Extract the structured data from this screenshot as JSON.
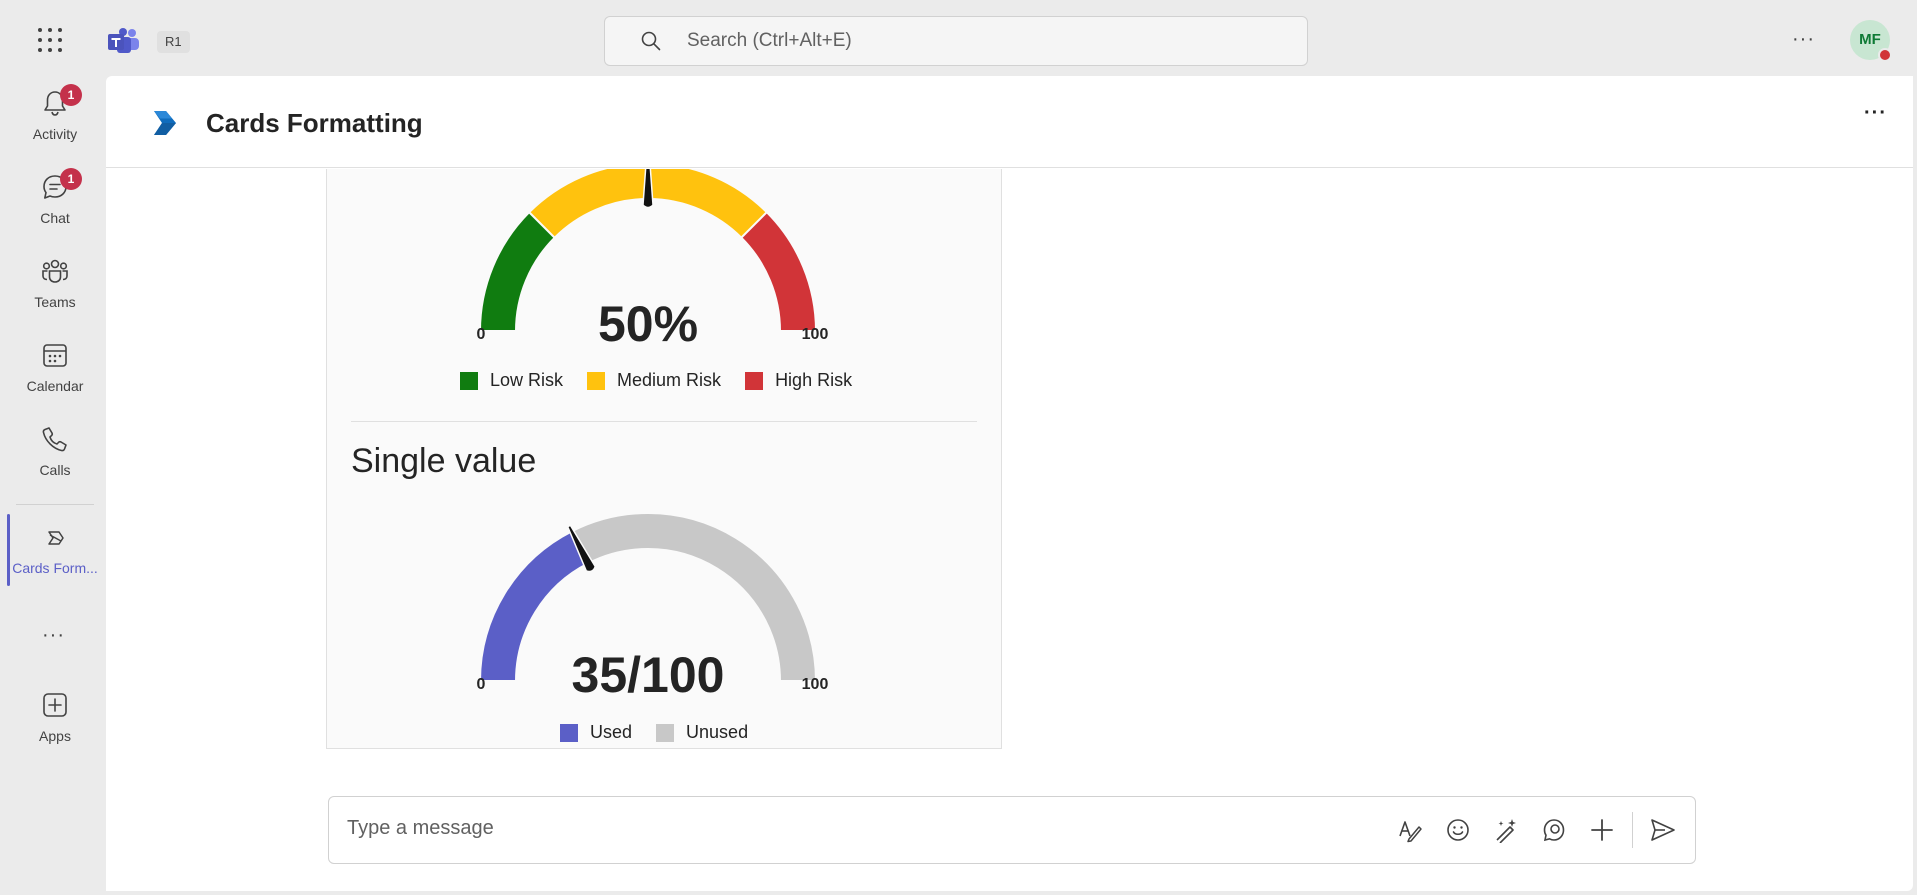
{
  "topbar": {
    "org_badge": "R1",
    "search_placeholder": "Search (Ctrl+Alt+E)",
    "avatar_initials": "MF"
  },
  "rail": {
    "items": [
      {
        "label": "Activity",
        "icon": "bell-icon",
        "badge": "1"
      },
      {
        "label": "Chat",
        "icon": "chat-icon",
        "badge": "1"
      },
      {
        "label": "Teams",
        "icon": "teams-icon"
      },
      {
        "label": "Calendar",
        "icon": "calendar-icon"
      },
      {
        "label": "Calls",
        "icon": "phone-icon"
      },
      {
        "label": "Cards Form...",
        "icon": "cards-formatting-icon",
        "active": true
      },
      {
        "label": "Apps",
        "icon": "apps-add-icon"
      }
    ]
  },
  "header": {
    "title": "Cards Formatting"
  },
  "card": {
    "gauge1": {
      "value_label": "50%",
      "min_label": "0",
      "max_label": "100",
      "legend": [
        {
          "label": "Low Risk",
          "color": "#107c10"
        },
        {
          "label": "Medium Risk",
          "color": "#ffc20e"
        },
        {
          "label": "High Risk",
          "color": "#d13438"
        }
      ],
      "value": 50
    },
    "section_title": "Single value",
    "gauge2": {
      "value_label": "35/100",
      "min_label": "0",
      "max_label": "100",
      "legend": [
        {
          "label": "Used",
          "color": "#5b5fc7"
        },
        {
          "label": "Unused",
          "color": "#c8c8c8"
        }
      ],
      "value": 35
    }
  },
  "composer": {
    "placeholder": "Type a message"
  }
}
